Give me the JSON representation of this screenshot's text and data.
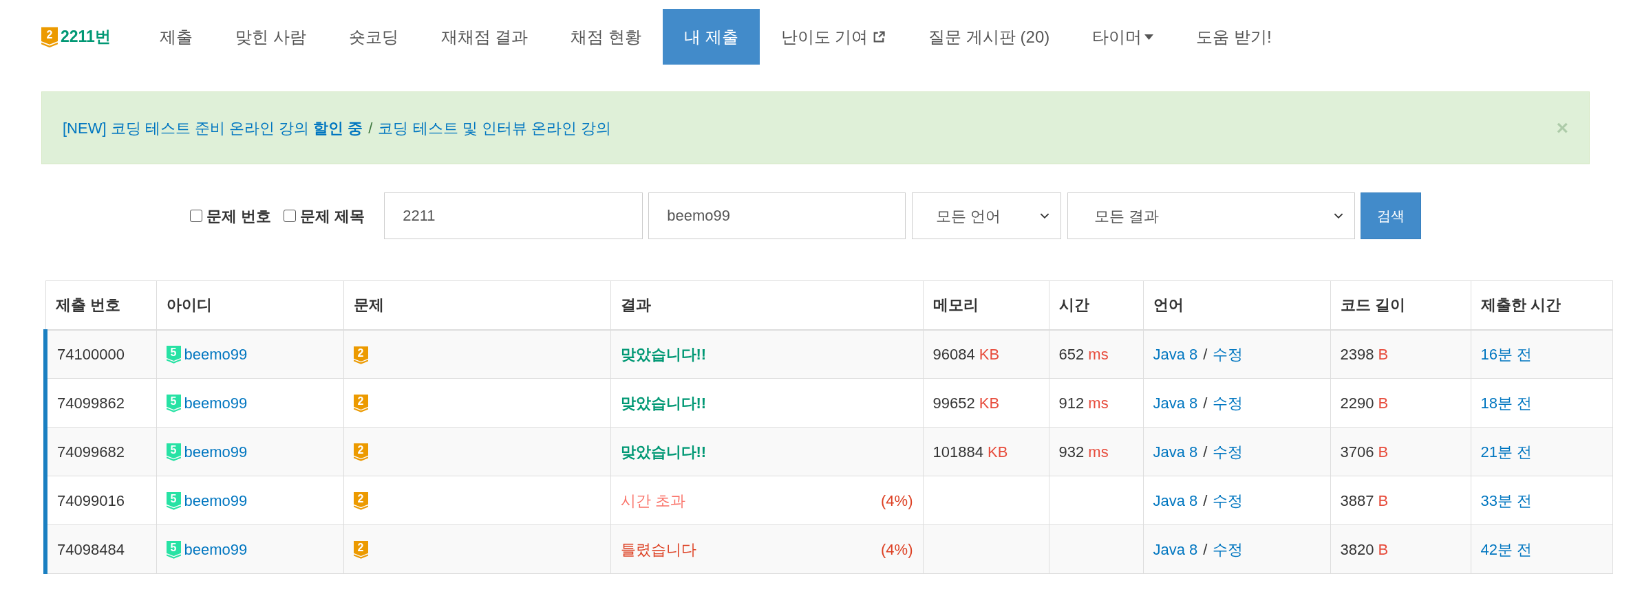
{
  "nav": [
    {
      "kind": "logo",
      "badge": "2",
      "label": "2211번",
      "selected": false
    },
    {
      "kind": "link",
      "label": "제출",
      "selected": false
    },
    {
      "kind": "link",
      "label": "맞힌 사람",
      "selected": false
    },
    {
      "kind": "link",
      "label": "숏코딩",
      "selected": false
    },
    {
      "kind": "link",
      "label": "재채점 결과",
      "selected": false
    },
    {
      "kind": "link",
      "label": "채점 현황",
      "selected": false
    },
    {
      "kind": "link",
      "label": "내 제출",
      "selected": true
    },
    {
      "kind": "external",
      "label": "난이도 기여",
      "selected": false
    },
    {
      "kind": "link",
      "label": "질문 게시판 (20)",
      "selected": false
    },
    {
      "kind": "dropdown",
      "label": "타이머",
      "selected": false
    },
    {
      "kind": "link",
      "label": "도움 받기!",
      "selected": false
    }
  ],
  "alert": {
    "links": [
      "[NEW] 코딩 테스트 준비 온라인 강의 **할인 중**",
      "코딩 테스트 및 인터뷰 온라인 강의"
    ],
    "separator": "/",
    "close": "×"
  },
  "search": {
    "checkboxes": [
      {
        "label": "문제 번호",
        "checked": false
      },
      {
        "label": "문제 제목",
        "checked": false
      }
    ],
    "problem_value": "2211",
    "user_value": "beemo99",
    "language": "모든 언어",
    "result": "모든 결과",
    "button": "검색"
  },
  "table": {
    "columns": [
      "제출 번호",
      "아이디",
      "문제",
      "결과",
      "메모리",
      "시간",
      "언어",
      "코드 길이",
      "제출한 시간"
    ],
    "rows": [
      {
        "id": "74100000",
        "tier": "5",
        "user": "beemo99",
        "problem_badge": "2",
        "result": "맞았습니다!!",
        "kind": "accepted",
        "memory": "96084",
        "memory_unit": "KB",
        "time": "652",
        "time_unit": "ms",
        "language": "Java 8",
        "edit": "수정",
        "length": "2398",
        "length_unit": "B",
        "submitted": "16분 전"
      },
      {
        "id": "74099862",
        "tier": "5",
        "user": "beemo99",
        "problem_badge": "2",
        "result": "맞았습니다!!",
        "kind": "accepted",
        "memory": "99652",
        "memory_unit": "KB",
        "time": "912",
        "time_unit": "ms",
        "language": "Java 8",
        "edit": "수정",
        "length": "2290",
        "length_unit": "B",
        "submitted": "18분 전"
      },
      {
        "id": "74099682",
        "tier": "5",
        "user": "beemo99",
        "problem_badge": "2",
        "result": "맞았습니다!!",
        "kind": "accepted",
        "memory": "101884",
        "memory_unit": "KB",
        "time": "932",
        "time_unit": "ms",
        "language": "Java 8",
        "edit": "수정",
        "length": "3706",
        "length_unit": "B",
        "submitted": "21분 전"
      },
      {
        "id": "74099016",
        "tier": "5",
        "user": "beemo99",
        "problem_badge": "2",
        "result": "시간 초과",
        "kind": "time_limit",
        "percent": "(4%)",
        "language": "Java 8",
        "edit": "수정",
        "length": "3887",
        "length_unit": "B",
        "submitted": "33분 전"
      },
      {
        "id": "74098484",
        "tier": "5",
        "user": "beemo99",
        "problem_badge": "2",
        "result": "틀렸습니다",
        "kind": "wrong",
        "percent": "(4%)",
        "language": "Java 8",
        "edit": "수정",
        "length": "3820",
        "length_unit": "B",
        "submitted": "42분 전"
      }
    ]
  }
}
